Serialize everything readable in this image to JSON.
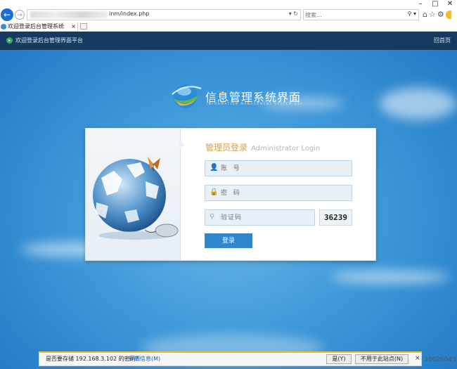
{
  "browser": {
    "window_controls": {
      "minimize": "–",
      "maximize": "□",
      "close": "✕"
    },
    "address": {
      "url_visible": "inm/index.php",
      "dropdown_icon": "chevron-down-icon",
      "refresh_icon": "refresh-icon"
    },
    "search": {
      "placeholder": "搜索..."
    },
    "tab": {
      "title": "欢迎登录后台管理系统",
      "close": "×"
    }
  },
  "page": {
    "topbar": {
      "title": "欢迎登录后台管理界面平台",
      "home_link": "回首页"
    },
    "logo": {
      "title": "信息管理系统界面",
      "subtitle": "INFORMATION MANAGEMENT SYSTEM GUI"
    },
    "login": {
      "heading": "管理员登录",
      "heading_en": "Administrator Login",
      "account_placeholder": "账  号",
      "password_placeholder": "密  码",
      "captcha_placeholder": "验证码",
      "captcha_value": "36239",
      "submit_label": "登录"
    }
  },
  "notification": {
    "message": "是否要存储 192.168.3.102 的密码?",
    "details_link": "详细信息(M)",
    "yes_button": "是(Y)",
    "never_button": "不用于此站点(N)",
    "close": "×"
  },
  "stray_text": "38626043",
  "colors": {
    "topbar": "#163b63",
    "accent_gold": "#d4a04a",
    "button_blue": "#2f86cc",
    "background_blue": "#3f99d9"
  }
}
